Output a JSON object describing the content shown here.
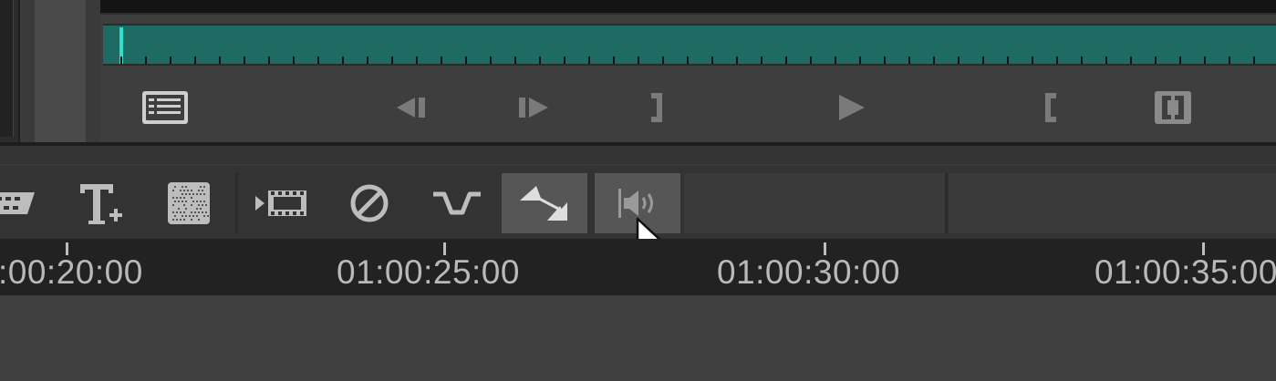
{
  "viewer": {
    "transport_buttons": [
      {
        "name": "clip-list-icon"
      },
      {
        "name": "step-back-icon"
      },
      {
        "name": "step-forward-icon"
      },
      {
        "name": "mark-out-icon"
      },
      {
        "name": "play-icon"
      },
      {
        "name": "mark-in-icon"
      },
      {
        "name": "match-frame-icon"
      }
    ],
    "scrubber_color": "#1e6b63",
    "playhead_color": "#2fe0c8"
  },
  "toolbar": {
    "tools": [
      {
        "name": "trim-tool-icon"
      },
      {
        "name": "text-add-icon"
      },
      {
        "name": "texture-icon"
      },
      {
        "name": "insert-clip-icon"
      },
      {
        "name": "disable-icon"
      },
      {
        "name": "transition-curve-icon"
      },
      {
        "name": "keyframe-triangles-icon",
        "active": true
      },
      {
        "name": "audio-level-icon",
        "active": true
      }
    ]
  },
  "ruler": {
    "timecodes": [
      ":00:20:00",
      "01:00:25:00",
      "01:00:30:00",
      "01:00:35:00"
    ]
  }
}
